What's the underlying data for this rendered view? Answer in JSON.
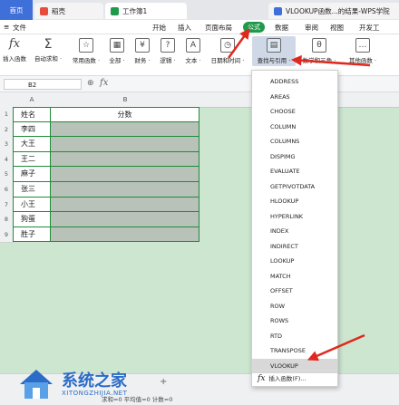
{
  "tabs": [
    {
      "label": "首页"
    },
    {
      "label": "稻壳"
    },
    {
      "label": "工作簿1"
    },
    {
      "label": "VLOOKUP函数...的结果-WPS学院"
    }
  ],
  "menu": {
    "file": "文件",
    "items": [
      "开始",
      "插入",
      "页面布局",
      "公式",
      "数据",
      "审阅",
      "视图",
      "开发工"
    ]
  },
  "toolbar": [
    {
      "label": "插入函数",
      "icon": "fx"
    },
    {
      "label": "自动求和 ·",
      "icon": "Σ"
    },
    {
      "label": "常用函数 ·",
      "icon": "☆"
    },
    {
      "label": "全部 ·",
      "icon": "▦"
    },
    {
      "label": "财务 ·",
      "icon": "¥"
    },
    {
      "label": "逻辑 ·",
      "icon": "?"
    },
    {
      "label": "文本 ·",
      "icon": "A"
    },
    {
      "label": "日期和时间 ·",
      "icon": "◷"
    },
    {
      "label": "查找与引用 ·",
      "icon": "▤"
    },
    {
      "label": "数学和三角 ·",
      "icon": "θ"
    },
    {
      "label": "其他函数 ·",
      "icon": "…"
    }
  ],
  "namebox": "B2",
  "columns": [
    "A",
    "B"
  ],
  "rows": [
    {
      "num": "1",
      "a": "姓名",
      "b": "分数"
    },
    {
      "num": "2",
      "a": "李四",
      "b": ""
    },
    {
      "num": "3",
      "a": "大王",
      "b": ""
    },
    {
      "num": "4",
      "a": "王二",
      "b": ""
    },
    {
      "num": "5",
      "a": "麻子",
      "b": ""
    },
    {
      "num": "6",
      "a": "张三",
      "b": ""
    },
    {
      "num": "7",
      "a": "小王",
      "b": ""
    },
    {
      "num": "8",
      "a": "狗蛋",
      "b": ""
    },
    {
      "num": "9",
      "a": "胜子",
      "b": ""
    }
  ],
  "functions": [
    "ADDRESS",
    "AREAS",
    "CHOOSE",
    "COLUMN",
    "COLUMNS",
    "DISPIMG",
    "EVALUATE",
    "GETPIVOTDATA",
    "HLOOKUP",
    "HYPERLINK",
    "INDEX",
    "INDIRECT",
    "LOOKUP",
    "MATCH",
    "OFFSET",
    "ROW",
    "ROWS",
    "RTD",
    "TRANSPOSE",
    "VLOOKUP"
  ],
  "highlighted_function": "VLOOKUP",
  "insert_function": "插入函数(F)...",
  "status": "求和=0 平均值=0 计数=0",
  "watermark": {
    "title": "系统之家",
    "sub": "XITONGZHIJIA.NET"
  },
  "colors": {
    "accent": "#1f9a4b",
    "home_tab": "#3f6fd8",
    "arrow": "#e0281e",
    "grid_bg": "#cde6d0"
  }
}
